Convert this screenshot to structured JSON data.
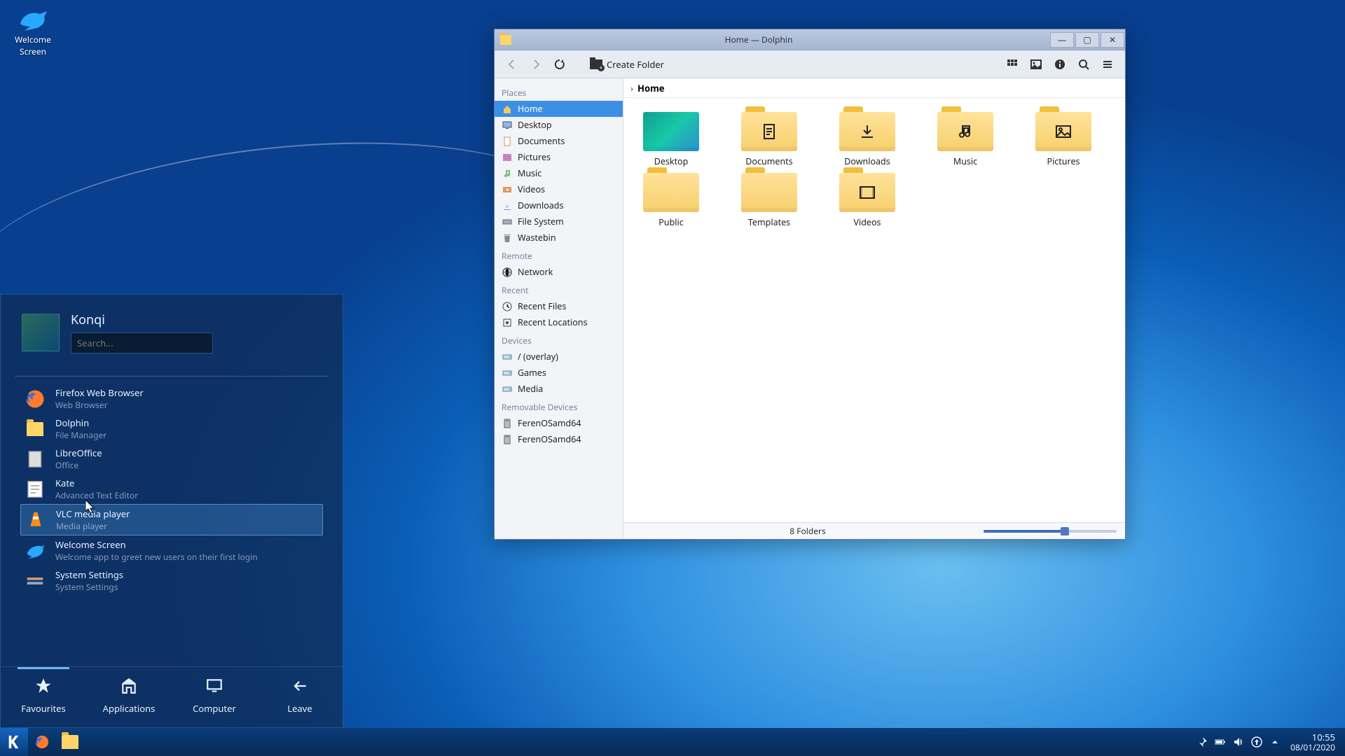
{
  "desktop": {
    "icons": [
      {
        "name": "welcome-screen-desktop-icon",
        "label": "Welcome\nScreen"
      }
    ]
  },
  "startmenu": {
    "user": "Konqi",
    "search_placeholder": "Search...",
    "favourites": [
      {
        "name": "firefox",
        "title": "Firefox Web Browser",
        "subtitle": "Web Browser",
        "icon": "firefox-icon"
      },
      {
        "name": "dolphin",
        "title": "Dolphin",
        "subtitle": "File Manager",
        "icon": "folder-icon"
      },
      {
        "name": "libreoffice",
        "title": "LibreOffice",
        "subtitle": "Office",
        "icon": "document-icon"
      },
      {
        "name": "kate",
        "title": "Kate",
        "subtitle": "Advanced Text Editor",
        "icon": "text-editor-icon"
      },
      {
        "name": "vlc",
        "title": "VLC media player",
        "subtitle": "Media player",
        "icon": "vlc-icon",
        "selected": true
      },
      {
        "name": "welcome-screen",
        "title": "Welcome Screen",
        "subtitle": "Welcome app to greet new users on their first login",
        "icon": "bird-icon"
      },
      {
        "name": "system-settings",
        "title": "System Settings",
        "subtitle": "System Settings",
        "icon": "settings-icon"
      }
    ],
    "tabs": [
      {
        "label": "Favourites",
        "icon": "star-icon",
        "active": true
      },
      {
        "label": "Applications",
        "icon": "apps-icon"
      },
      {
        "label": "Computer",
        "icon": "computer-icon"
      },
      {
        "label": "Leave",
        "icon": "leave-icon"
      }
    ]
  },
  "dolphin": {
    "title": "Home — Dolphin",
    "toolbar": {
      "create_folder": "Create Folder"
    },
    "sidebar": {
      "places_label": "Places",
      "places": [
        {
          "label": "Home",
          "icon": "home-icon",
          "active": true
        },
        {
          "label": "Desktop",
          "icon": "desktop-icon"
        },
        {
          "label": "Documents",
          "icon": "documents-icon"
        },
        {
          "label": "Pictures",
          "icon": "pictures-icon"
        },
        {
          "label": "Music",
          "icon": "music-icon"
        },
        {
          "label": "Videos",
          "icon": "videos-icon"
        },
        {
          "label": "Downloads",
          "icon": "downloads-icon"
        },
        {
          "label": "File System",
          "icon": "drive-icon"
        },
        {
          "label": "Wastebin",
          "icon": "trash-icon"
        }
      ],
      "remote_label": "Remote",
      "remote": [
        {
          "label": "Network",
          "icon": "network-icon"
        }
      ],
      "recent_label": "Recent",
      "recent": [
        {
          "label": "Recent Files",
          "icon": "clock-icon"
        },
        {
          "label": "Recent Locations",
          "icon": "clock-location-icon"
        }
      ],
      "devices_label": "Devices",
      "devices": [
        {
          "label": "/ (overlay)",
          "icon": "partition-icon"
        },
        {
          "label": "Games",
          "icon": "partition-icon"
        },
        {
          "label": "Media",
          "icon": "partition-icon"
        }
      ],
      "removable_label": "Removable Devices",
      "removable": [
        {
          "label": "FerenOSamd64",
          "icon": "usb-icon"
        },
        {
          "label": "FerenOSamd64",
          "icon": "usb-icon"
        }
      ]
    },
    "path": "Home",
    "items": [
      {
        "label": "Desktop",
        "kind": "desktop"
      },
      {
        "label": "Documents",
        "glyph": "doc"
      },
      {
        "label": "Downloads",
        "glyph": "down"
      },
      {
        "label": "Music",
        "glyph": "music"
      },
      {
        "label": "Pictures",
        "glyph": "pic"
      },
      {
        "label": "Public",
        "glyph": ""
      },
      {
        "label": "Templates",
        "glyph": ""
      },
      {
        "label": "Videos",
        "glyph": "vid"
      }
    ],
    "status": "8 Folders"
  },
  "taskbar": {
    "clock": {
      "time": "10:55",
      "date": "08/01/2020"
    }
  }
}
